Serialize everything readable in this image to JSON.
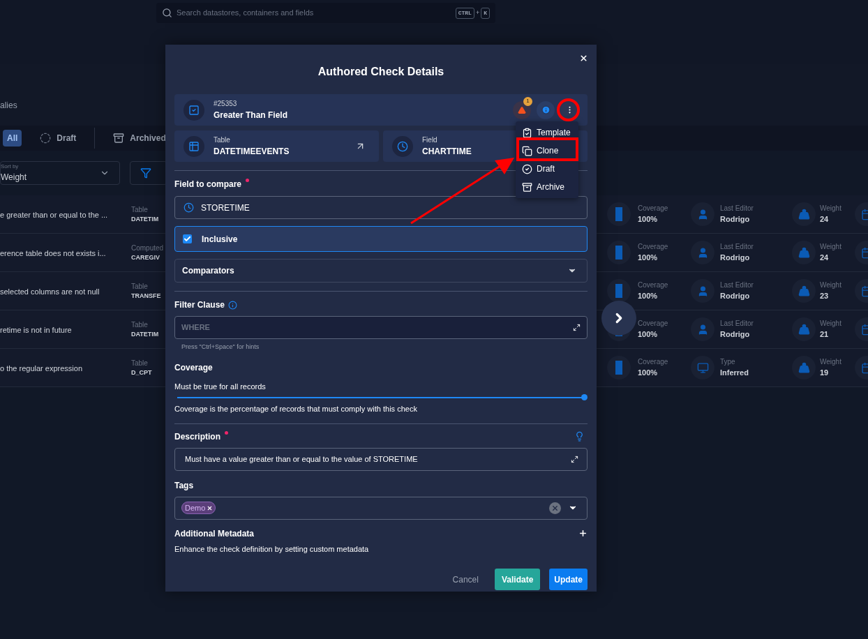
{
  "search": {
    "placeholder": "Search datastores, containers and fields",
    "keys": [
      "CTRL",
      "+",
      "K"
    ]
  },
  "page_title": "alies",
  "status_tabs": [
    {
      "label": "All",
      "kind": "all",
      "selected": true
    },
    {
      "label": "Draft",
      "kind": "draft",
      "selected": false
    },
    {
      "label": "Archived",
      "kind": "archived",
      "selected": false
    }
  ],
  "sort": {
    "label": "Sort by",
    "value": "Weight"
  },
  "rows": [
    {
      "description": "e greater than or equal to the ...",
      "source_label": "Table",
      "source_value": "DATETIM",
      "coverage_label": "Coverage",
      "coverage": "100%",
      "kind": "editor",
      "meta_label": "Last Editor",
      "meta_value": "Rodrigo",
      "weight_label": "Weight",
      "weight": "24"
    },
    {
      "description": "erence table does not exists i...",
      "source_label": "Computed",
      "source_value": "CAREGIV",
      "coverage_label": "Coverage",
      "coverage": "100%",
      "kind": "editor",
      "meta_label": "Last Editor",
      "meta_value": "Rodrigo",
      "weight_label": "Weight",
      "weight": "24"
    },
    {
      "description": "selected columns are not null",
      "source_label": "Table",
      "source_value": "TRANSFE",
      "coverage_label": "Coverage",
      "coverage": "100%",
      "kind": "editor",
      "meta_label": "Last Editor",
      "meta_value": "Rodrigo",
      "weight_label": "Weight",
      "weight": "23"
    },
    {
      "description": "retime is not in future",
      "source_label": "Table",
      "source_value": "DATETIM",
      "coverage_label": "Coverage",
      "coverage": "100%",
      "kind": "editor",
      "meta_label": "Last Editor",
      "meta_value": "Rodrigo",
      "weight_label": "Weight",
      "weight": "21"
    },
    {
      "description": "o the regular expression",
      "source_label": "Table",
      "source_value": "D_CPT",
      "coverage_label": "Coverage",
      "coverage": "100%",
      "kind": "type",
      "meta_label": "Type",
      "meta_value": "Inferred",
      "weight_label": "Weight",
      "weight": "19"
    }
  ],
  "modal": {
    "title": "Authored Check Details",
    "check": {
      "id": "#25353",
      "name": "Greater Than Field",
      "alert_count": "1"
    },
    "menu": [
      {
        "label": "Template",
        "kind": "template"
      },
      {
        "label": "Clone",
        "kind": "clone"
      },
      {
        "label": "Draft",
        "kind": "draft"
      },
      {
        "label": "Archive",
        "kind": "archive"
      }
    ],
    "container": {
      "label": "Table",
      "value": "DATETIMEEVENTS"
    },
    "field": {
      "label": "Field",
      "value": "CHARTTIME"
    },
    "field_to_compare": {
      "label": "Field to compare",
      "required": true,
      "value": "STORETIME"
    },
    "inclusive": {
      "label": "Inclusive",
      "checked": true
    },
    "comparators": {
      "label": "Comparators"
    },
    "filter": {
      "label": "Filter Clause",
      "placeholder": "WHERE",
      "hint": "Press \"Ctrl+Space\" for hints"
    },
    "coverage": {
      "label": "Coverage",
      "caption": "Must be true for all records",
      "level": 1,
      "note": "Coverage is the percentage of records that must comply with this check"
    },
    "description": {
      "label": "Description",
      "required": true,
      "value": "Must have a value greater than or equal to the value of STORETIME"
    },
    "tags": {
      "label": "Tags",
      "items": [
        "Demo"
      ]
    },
    "metadata": {
      "label": "Additional Metadata",
      "note": "Enhance the check definition by setting custom metadata"
    },
    "buttons": [
      {
        "label": "Cancel",
        "kind": "cancel"
      },
      {
        "label": "Validate",
        "kind": "validate"
      },
      {
        "label": "Update",
        "kind": "primary"
      }
    ]
  }
}
